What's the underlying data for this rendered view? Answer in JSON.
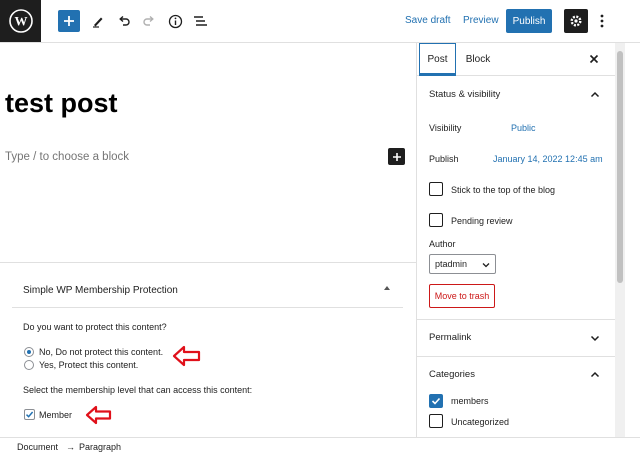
{
  "toolbar": {
    "logo_icon": "wordpress-logo",
    "add_block_icon": "plus-icon",
    "tools_icon": "pen-icon",
    "undo_icon": "undo-icon",
    "redo_icon": "redo-icon",
    "info_icon": "info-icon",
    "outline_icon": "list-view-icon",
    "save_draft": "Save draft",
    "preview": "Preview",
    "publish": "Publish",
    "settings_icon": "gear-icon",
    "more_icon": "vertical-ellipsis-icon"
  },
  "editor": {
    "title": "test post",
    "placeholder": "Type / to choose a block"
  },
  "meta_box": {
    "title": "Simple WP Membership Protection",
    "question": "Do you want to protect this content?",
    "options": [
      {
        "label": "No, Do not protect this content.",
        "selected": true
      },
      {
        "label": "Yes, Protect this content.",
        "selected": false
      }
    ],
    "level_prompt": "Select the membership level that can access this content:",
    "levels": [
      {
        "label": "Member",
        "checked": true
      }
    ]
  },
  "statusbar": {
    "crumbs": [
      "Document",
      "Paragraph"
    ],
    "separator": "→"
  },
  "sidebar": {
    "tabs": [
      {
        "label": "Post",
        "active": true
      },
      {
        "label": "Block",
        "active": false
      }
    ],
    "close_icon": "close-icon",
    "status_visibility": {
      "title": "Status & visibility",
      "visibility_label": "Visibility",
      "visibility_value": "Public",
      "publish_label": "Publish",
      "publish_value": "January 14, 2022 12:45 am",
      "sticky_label": "Stick to the top of the blog",
      "pending_label": "Pending review",
      "author_label": "Author",
      "author_value": "ptadmin",
      "trash": "Move to trash"
    },
    "permalink": {
      "title": "Permalink"
    },
    "categories": {
      "title": "Categories",
      "items": [
        {
          "label": "members",
          "checked": true
        },
        {
          "label": "Uncategorized",
          "checked": false
        }
      ]
    }
  },
  "colors": {
    "accent": "#2271b1",
    "annotation_arrow": "#e0101a",
    "danger": "#cc1818",
    "dark": "#1e1e1e"
  }
}
